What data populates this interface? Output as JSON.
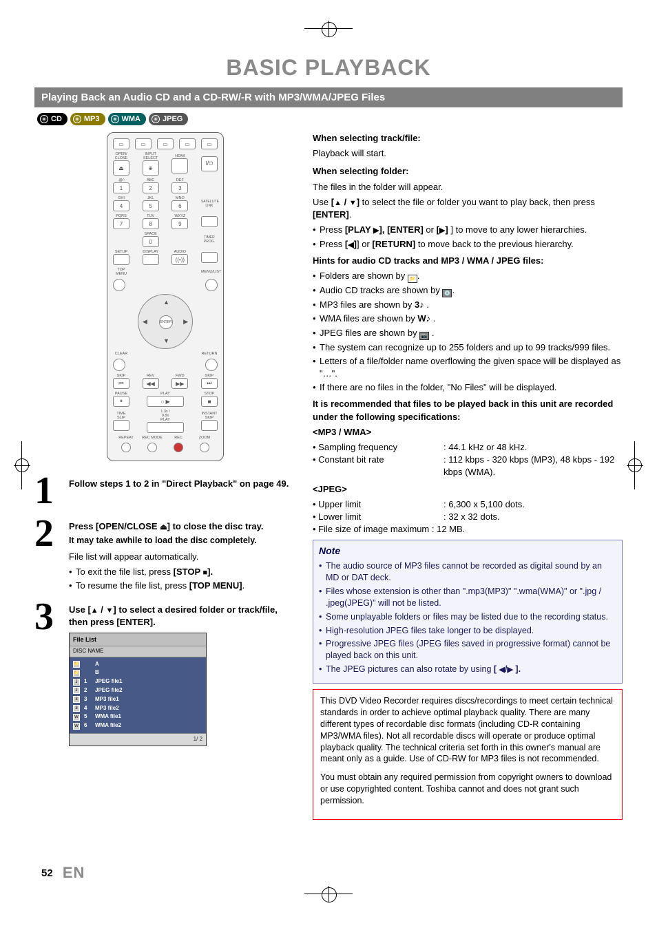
{
  "page_title": "BASIC PLAYBACK",
  "subsection": "Playing Back an Audio CD and a CD-RW/-R with MP3/WMA/JPEG Files",
  "badges": {
    "cd": "CD",
    "mp3": "MP3",
    "wma": "WMA",
    "jpeg": "JPEG"
  },
  "remote": {
    "row1_labels": [
      "OPEN/\nCLOSE",
      "INPUT\nSELECT",
      "HDMI",
      ""
    ],
    "row2_labels": [
      ".@/:",
      "ABC",
      "DEF"
    ],
    "row2_nums": [
      "1",
      "2",
      "3"
    ],
    "row3_labels": [
      "GHI",
      "JKL",
      "MNO"
    ],
    "row3_nums": [
      "4",
      "5",
      "6"
    ],
    "row3_side": "SATELLITE\nLINK",
    "row4_labels": [
      "PQRS",
      "TUV",
      "WXYZ"
    ],
    "row4_nums": [
      "7",
      "8",
      "9"
    ],
    "row5_labels": [
      "",
      "SPACE",
      ""
    ],
    "row5_nums": [
      "",
      "0",
      ""
    ],
    "row5_side": "TIMER\nPROG.",
    "row6_labels": [
      "SETUP",
      "DISPLAY",
      "AUDIO"
    ],
    "dpad_top_left": "TOP MENU",
    "dpad_top_right": "MENU/LIST",
    "dpad_center": "ENTER",
    "dpad_bot_left": "CLEAR",
    "dpad_bot_right": "RETURN",
    "transport_row1_labels": [
      "SKIP",
      "REV",
      "FWD",
      "SKIP"
    ],
    "transport_row2_labels": [
      "PAUSE",
      "",
      "PLAY",
      "STOP"
    ],
    "transport_row3_labels": [
      "TIME SLIP",
      "",
      "1.3x / 0.8x PLAY",
      "INSTANT SKIP"
    ],
    "transport_row4_labels": [
      "REPEAT",
      "REC MODE",
      "REC",
      "ZOOM"
    ]
  },
  "steps": {
    "s1": {
      "num": "1",
      "head": "Follow steps 1 to 2 in \"Direct Playback\" on page 49."
    },
    "s2": {
      "num": "2",
      "head_prefix": "Press [OPEN/CLOSE ",
      "head_suffix": "] to close the disc tray.",
      "sub": "It may take awhile to load the disc completely.",
      "line1": "File list will appear automatically.",
      "bullet1_prefix": "To exit the file list, press ",
      "bullet1_bold": "[STOP ",
      "bullet1_suffix": "].",
      "bullet2_prefix": "To resume the file list, press ",
      "bullet2_bold": "[TOP MENU]",
      "bullet2_suffix": "."
    },
    "s3": {
      "num": "3",
      "head_prefix": "Use [",
      "head_mid": " / ",
      "head_suffix": "] to select a desired folder or track/file, then press [ENTER]."
    }
  },
  "filelist": {
    "header": "File List",
    "sub": "DISC NAME",
    "rows": [
      {
        "icon": "📁",
        "idx": "",
        "name": "A"
      },
      {
        "icon": "📁",
        "idx": "",
        "name": "B"
      },
      {
        "icon": "J",
        "idx": "1",
        "name": "JPEG file1"
      },
      {
        "icon": "J",
        "idx": "2",
        "name": "JPEG file2"
      },
      {
        "icon": "3",
        "idx": "3",
        "name": "MP3  file1"
      },
      {
        "icon": "3",
        "idx": "4",
        "name": "MP3  file2"
      },
      {
        "icon": "W",
        "idx": "5",
        "name": "WMA file1"
      },
      {
        "icon": "W",
        "idx": "6",
        "name": "WMA file2"
      }
    ],
    "foot": "1/  2"
  },
  "right": {
    "sel_track_h": "When selecting track/file:",
    "sel_track_t": "Playback will start.",
    "sel_folder_h": "When selecting folder:",
    "sel_folder_t1": "The files in the folder will appear.",
    "sel_folder_t2_pre": "Use ",
    "sel_folder_t2_mid": " / ",
    "sel_folder_t2_post": " to select the file or folder you want to play back, then press ",
    "sel_folder_t2_enter": "[ENTER]",
    "sel_folder_t2_end": ".",
    "b1_pre": "Press ",
    "b1_play": "[PLAY ",
    "b1_mid1": "], ",
    "b1_enter": "[ENTER]",
    "b1_mid2": " or ",
    "b1_r": "[",
    "b1_suf": "] to move to any lower hierarchies.",
    "b2_pre": "Press ",
    "b2_l": "[",
    "b2_mid": "] or ",
    "b2_ret": "[RETURN]",
    "b2_suf": " to move back to the previous hierarchy.",
    "hints_h": "Hints for audio CD tracks and MP3 / WMA / JPEG files:",
    "h1": "Folders are shown by ",
    "h2": "Audio CD tracks are shown by ",
    "h3": "MP3 files are shown by ",
    "h4": "WMA files are shown by ",
    "h5": "JPEG files are shown by ",
    "dot": ".",
    "h3_sym": "3♪",
    "h4_sym": "W♪",
    "h6": "The system can recognize up to 255 folders and up to 99 tracks/999 files.",
    "h7": "Letters of a file/folder name overflowing the given space will be displayed as \"…\".",
    "h8": "If there are no files in the folder, \"No Files\" will be displayed.",
    "rec_h1": "It is recommended that files to be played back in this unit are recorded under the following specifications:",
    "mp3wma_h": "<MP3 / WMA>",
    "kv1k": "• Sampling frequency",
    "kv1v": ": 44.1 kHz or 48 kHz.",
    "kv2k": "• Constant bit rate",
    "kv2v": ": 112 kbps - 320 kbps (MP3), 48 kbps - 192 kbps (WMA).",
    "jpeg_h": "<JPEG>",
    "kv3k": "• Upper limit",
    "kv3v": ": 6,300 x 5,100 dots.",
    "kv4k": "• Lower limit",
    "kv4v": ": 32 x 32 dots.",
    "kv5": "• File size of image maximum : 12 MB."
  },
  "note": {
    "title": "Note",
    "n1": "The audio source of MP3 files cannot be recorded as digital sound by an MD or DAT deck.",
    "n2": "Files whose extension is other than \".mp3(MP3)\" \".wma(WMA)\" or \".jpg / .jpeg(JPEG)\" will not be listed.",
    "n3": "Some unplayable folders or files may be listed due to the recording status.",
    "n4": "High-resolution JPEG files take longer to be displayed.",
    "n5": "Progressive JPEG files (JPEG files saved in progressive format) cannot be played back on this unit.",
    "n6_pre": "The JPEG pictures can also rotate by using ",
    "n6_b": "[ ",
    "n6_mid": "/",
    "n6_suf": " ].",
    "n6_end": ""
  },
  "redbox": {
    "p1": "This DVD Video Recorder requires discs/recordings to meet certain technical standards in order to achieve optimal playback quality. There are many different types of recordable disc formats (including CD-R containing MP3/WMA files). Not all recordable discs will operate or produce optimal playback quality. The technical criteria set forth in this owner's manual are meant only as a guide. Use of CD-RW for MP3 files is not recommended.",
    "p2": "You must obtain any required permission from copyright owners to download or use copyrighted content. Toshiba cannot and does not grant such permission."
  },
  "footer": {
    "page": "52",
    "lang": "EN"
  }
}
